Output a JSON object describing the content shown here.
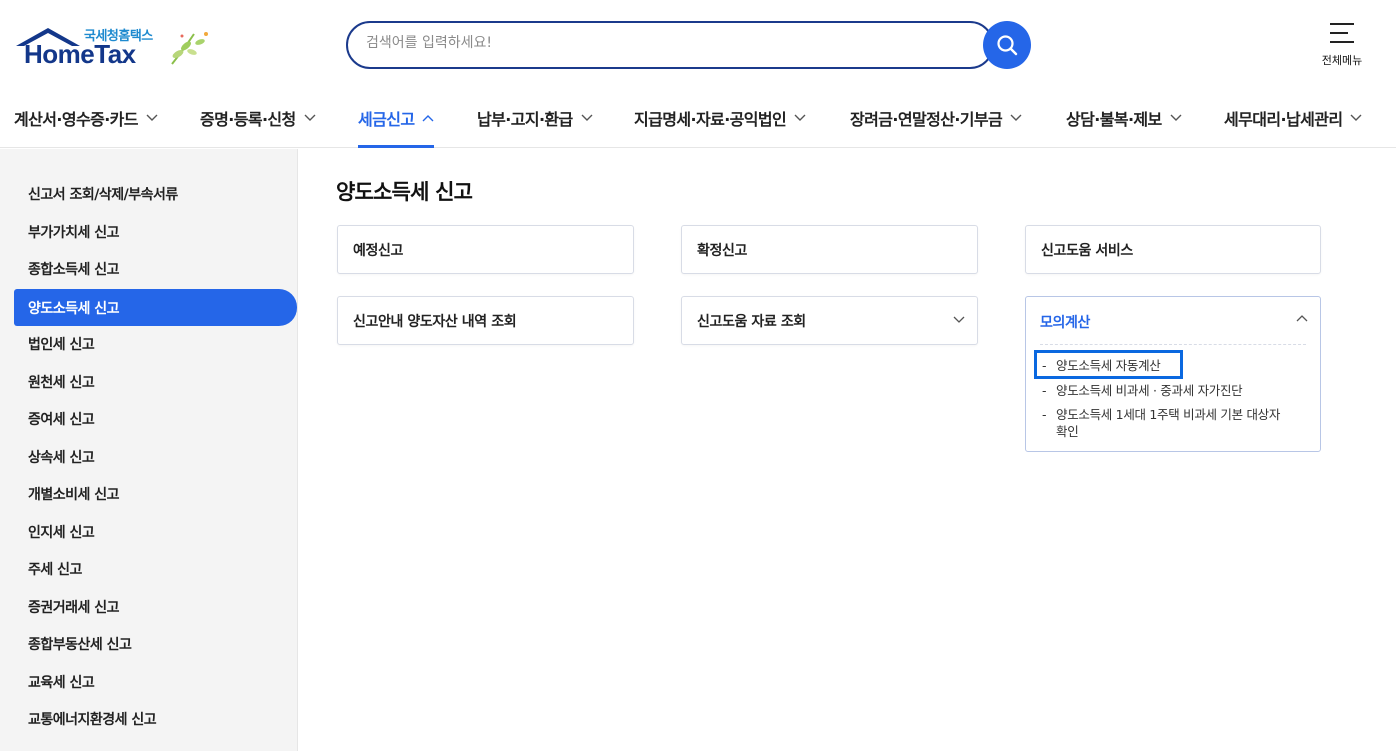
{
  "header": {
    "logo_sub": "국세청홈택스",
    "logo_main": "HomeTax",
    "search_placeholder": "검색어를 입력하세요!",
    "all_menu_label": "전체메뉴"
  },
  "gnb": [
    {
      "label": "계산서·영수증·카드"
    },
    {
      "label": "증명·등록·신청"
    },
    {
      "label": "세금신고",
      "active": true
    },
    {
      "label": "납부·고지·환급"
    },
    {
      "label": "지급명세·자료·공익법인"
    },
    {
      "label": "장려금·연말정산·기부금"
    },
    {
      "label": "상담·불복·제보"
    },
    {
      "label": "세무대리·납세관리"
    }
  ],
  "sidebar": {
    "items": [
      {
        "label": "신고서 조회/삭제/부속서류"
      },
      {
        "label": "부가가치세 신고"
      },
      {
        "label": "종합소득세 신고"
      },
      {
        "label": "양도소득세 신고",
        "active": true
      },
      {
        "label": "법인세 신고"
      },
      {
        "label": "원천세 신고"
      },
      {
        "label": "증여세 신고"
      },
      {
        "label": "상속세 신고"
      },
      {
        "label": "개별소비세 신고"
      },
      {
        "label": "인지세 신고"
      },
      {
        "label": "주세 신고"
      },
      {
        "label": "증권거래세 신고"
      },
      {
        "label": "종합부동산세 신고"
      },
      {
        "label": "교육세 신고"
      },
      {
        "label": "교통에너지환경세 신고"
      }
    ]
  },
  "main": {
    "title": "양도소득세 신고",
    "cards": [
      {
        "label": "예정신고"
      },
      {
        "label": "확정신고"
      },
      {
        "label": "신고도움 서비스"
      },
      {
        "label": "신고안내 양도자산 내역 조회"
      },
      {
        "label": "신고도움 자료 조회"
      }
    ],
    "open_card": {
      "title": "모의계산",
      "links": [
        {
          "label": "양도소득세 자동계산"
        },
        {
          "label": "양도소득세 비과세 · 중과세 자가진단"
        },
        {
          "label": "양도소득세 1세대 1주택 비과세 기본 대상자"
        },
        {
          "label": "확인"
        }
      ]
    }
  },
  "colors": {
    "accent": "#2566e8",
    "navy": "#13378a",
    "highlight": "#0a68e0"
  }
}
